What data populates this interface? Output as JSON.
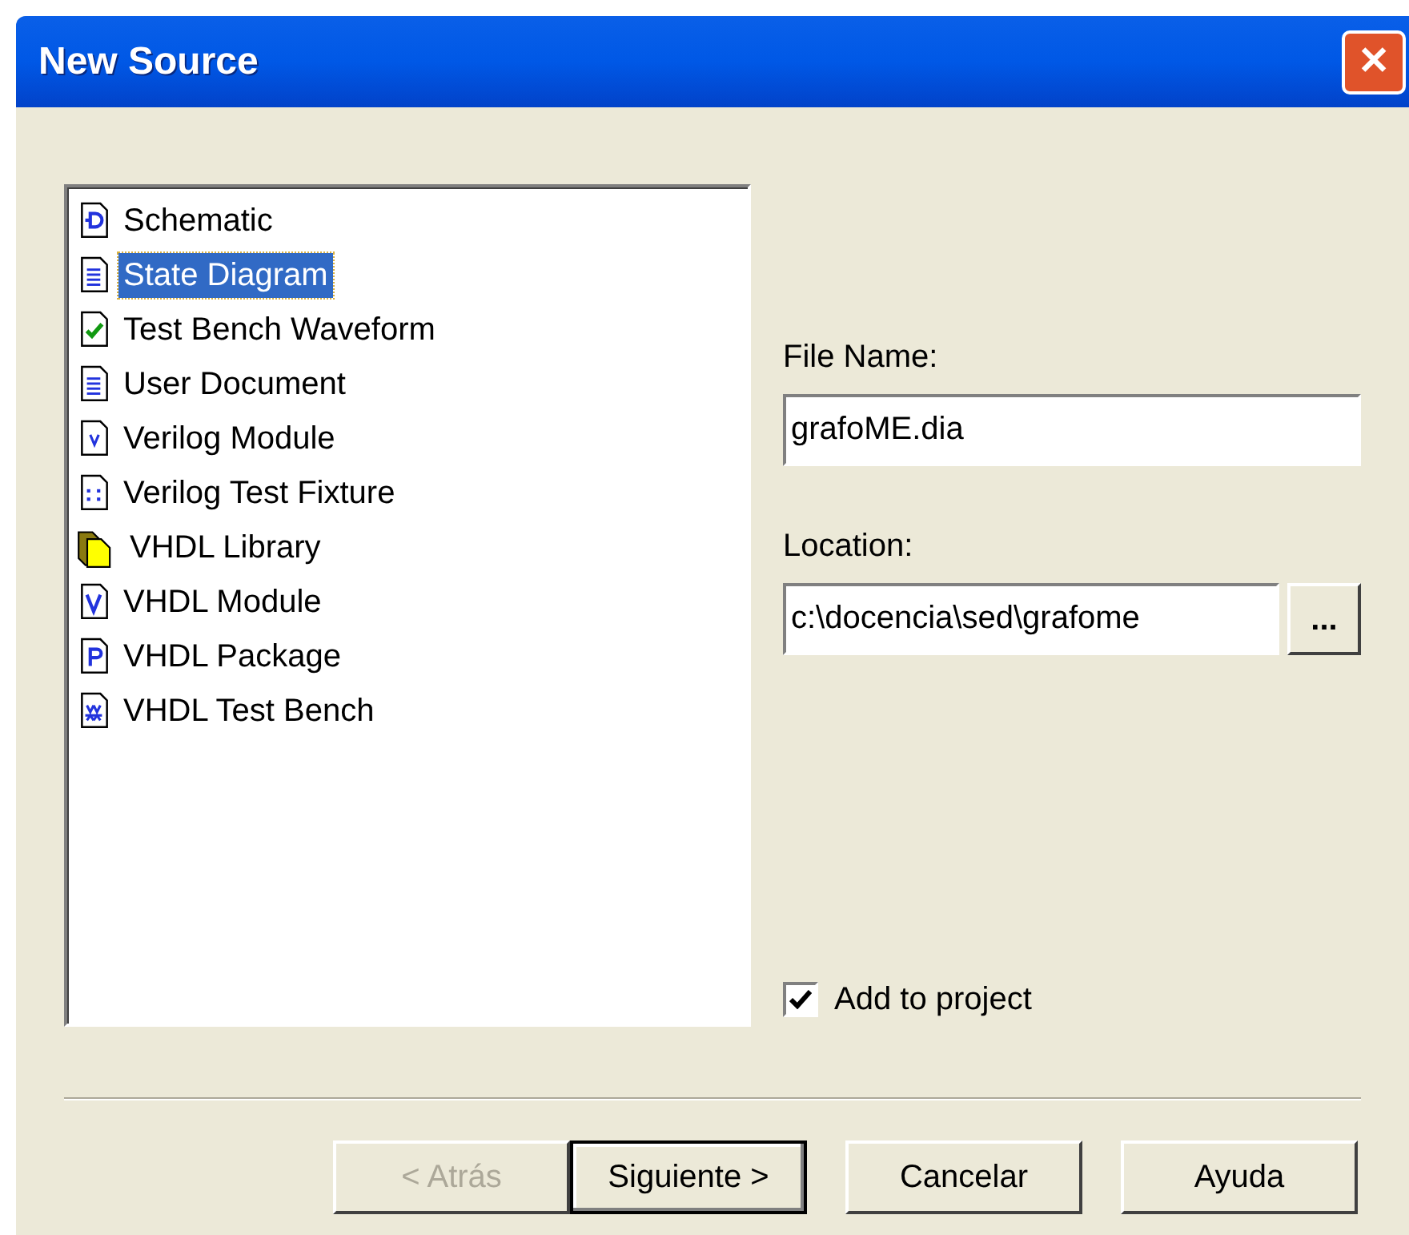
{
  "window": {
    "title": "New Source",
    "close": "✕"
  },
  "source_types": [
    {
      "label": "Schematic",
      "kind": "schematic",
      "selected": false
    },
    {
      "label": "State Diagram",
      "kind": "document",
      "selected": true
    },
    {
      "label": "Test Bench Waveform",
      "kind": "waveform",
      "selected": false
    },
    {
      "label": "User Document",
      "kind": "document",
      "selected": false
    },
    {
      "label": "Verilog Module",
      "kind": "verilog",
      "selected": false
    },
    {
      "label": "Verilog Test Fixture",
      "kind": "fixture",
      "selected": false
    },
    {
      "label": "VHDL Library",
      "kind": "library",
      "selected": false
    },
    {
      "label": "VHDL Module",
      "kind": "vhdl",
      "selected": false
    },
    {
      "label": "VHDL Package",
      "kind": "package",
      "selected": false
    },
    {
      "label": "VHDL Test Bench",
      "kind": "testbench",
      "selected": false
    }
  ],
  "file_name": {
    "label": "File Name:",
    "value": "grafoME.dia"
  },
  "location": {
    "label": "Location:",
    "value": "c:\\docencia\\sed\\grafome",
    "browse": "..."
  },
  "add_to_project": {
    "label": "Add to project",
    "checked": true
  },
  "buttons": [
    {
      "label": "< Atrás",
      "disabled": true,
      "default": false
    },
    {
      "label": "Siguiente >",
      "disabled": false,
      "default": true
    },
    {
      "label": "Cancelar",
      "disabled": false,
      "default": false
    },
    {
      "label": "Ayuda",
      "disabled": false,
      "default": false
    }
  ]
}
